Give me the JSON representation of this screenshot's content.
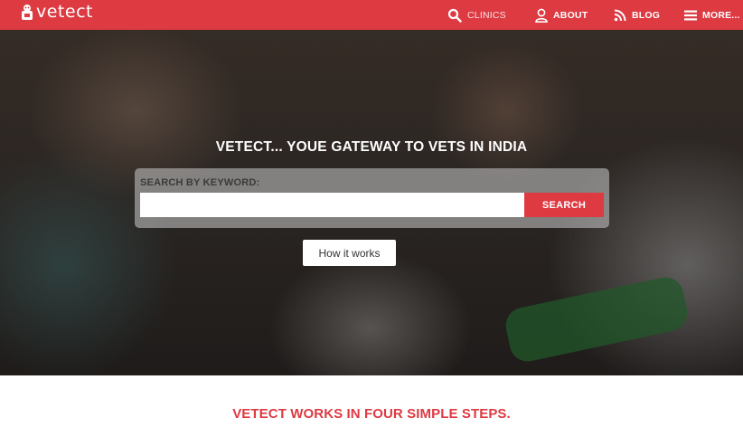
{
  "app": {
    "logo_text": "vetect"
  },
  "nav": {
    "clinics": "CLINICS",
    "about": "ABOUT",
    "blog": "BLOG",
    "more": "MORE..."
  },
  "icons": {
    "logo": "dog-badge-icon",
    "clinics": "search-icon",
    "about": "user-icon",
    "blog": "rss-icon",
    "more": "menu-icon"
  },
  "hero": {
    "title": "VETECT... YOUE GATEWAY TO VETS IN INDIA",
    "search_label": "SEARCH BY KEYWORD:",
    "search_value": "",
    "search_placeholder": "",
    "search_button": "SEARCH",
    "how_it_works": "How it works"
  },
  "section": {
    "steps_title": "VETECT WORKS IN FOUR SIMPLE STEPS."
  },
  "colors": {
    "brand": "#dd3a42",
    "text_dark": "#333333",
    "white": "#ffffff"
  }
}
